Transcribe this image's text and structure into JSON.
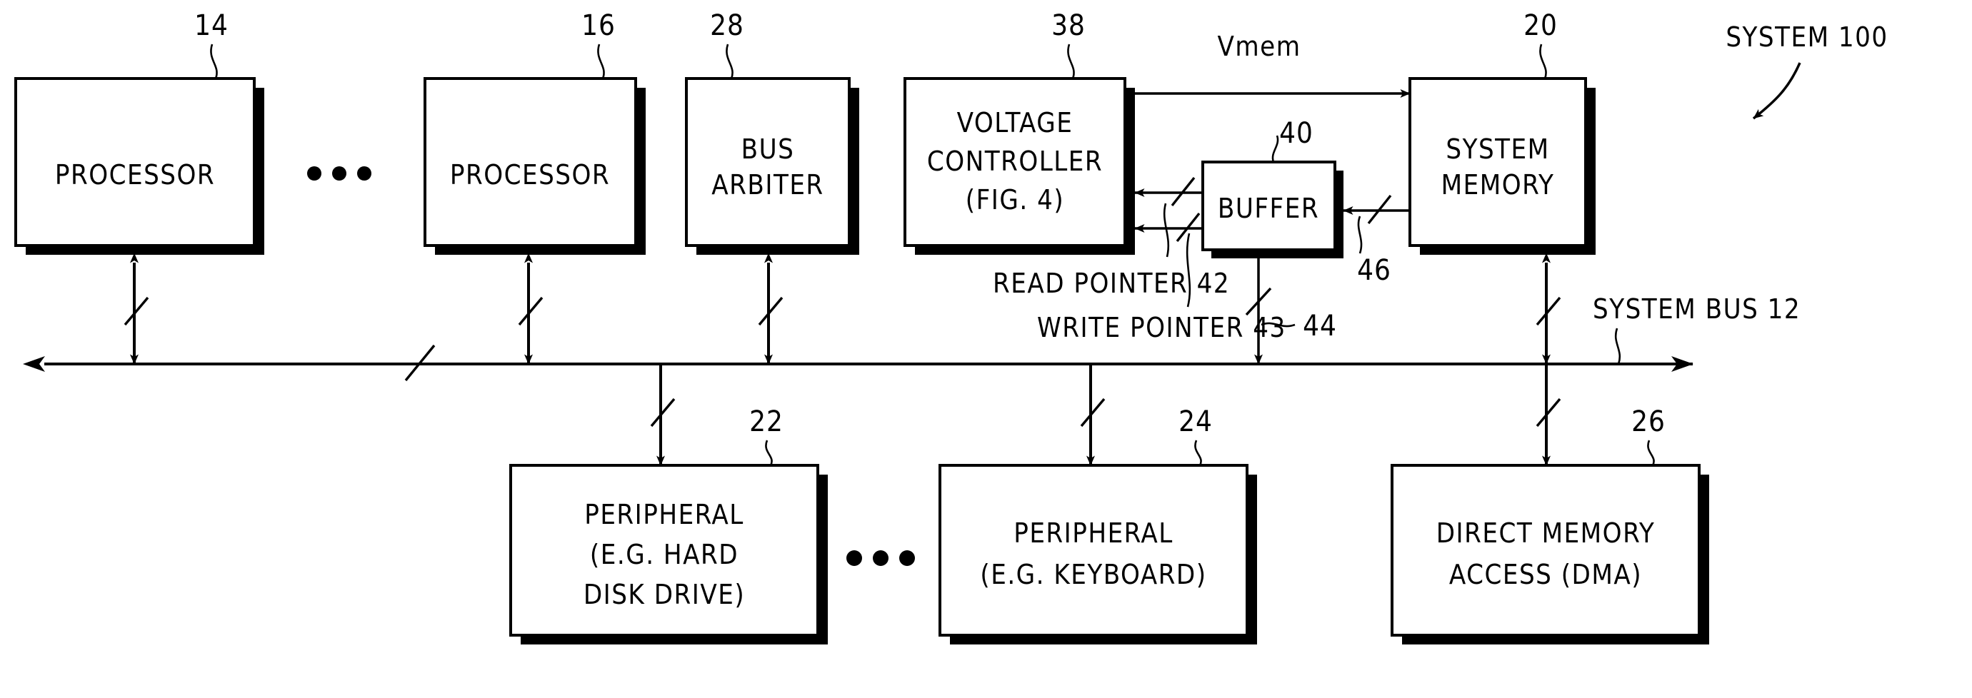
{
  "figure": {
    "title_label": "SYSTEM 100",
    "blocks": [
      {
        "id": "processor-1",
        "lines": [
          "PROCESSOR"
        ],
        "ref": "14"
      },
      {
        "id": "processor-2",
        "lines": [
          "PROCESSOR"
        ],
        "ref": "16"
      },
      {
        "id": "bus-arbiter",
        "lines": [
          "BUS",
          "ARBITER"
        ],
        "ref": "28"
      },
      {
        "id": "voltage-controller",
        "lines": [
          "VOLTAGE",
          "CONTROLLER",
          "(FIG. 4)"
        ],
        "ref": "38"
      },
      {
        "id": "buffer",
        "lines": [
          "BUFFER"
        ],
        "ref": "40"
      },
      {
        "id": "system-memory",
        "lines": [
          "SYSTEM",
          "MEMORY"
        ],
        "ref": "20"
      },
      {
        "id": "peripheral-hdd",
        "lines": [
          "PERIPHERAL",
          "(E.G. HARD",
          "DISK DRIVE)"
        ],
        "ref": "22"
      },
      {
        "id": "peripheral-kbd",
        "lines": [
          "PERIPHERAL",
          "(E.G. KEYBOARD)"
        ],
        "ref": "24"
      },
      {
        "id": "dma",
        "lines": [
          "DIRECT MEMORY",
          "ACCESS (DMA)"
        ],
        "ref": "26"
      }
    ],
    "signal_labels": {
      "vmem": "Vmem",
      "read_pointer": "READ POINTER 42",
      "write_pointer": "WRITE POINTER 43",
      "system_bus": "SYSTEM BUS 12",
      "ref_40": "40",
      "ref_44": "44",
      "ref_46": "46"
    },
    "ellipsis_glyph": "•••",
    "colors": {
      "ink": "#000000",
      "paper": "#ffffff"
    }
  }
}
